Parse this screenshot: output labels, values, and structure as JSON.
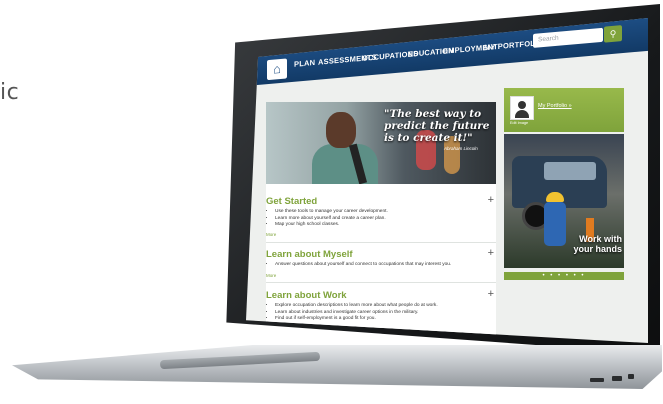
{
  "side_text": "ic",
  "nav": {
    "home_icon": "home-icon",
    "items": [
      "PLAN",
      "ASSESSMENTS",
      "OCCUPATIONS",
      "EDUCATION",
      "EMPLOYMENT",
      "MY PORTFOLIO"
    ],
    "search_placeholder": "Search",
    "search_icon": "search-icon"
  },
  "hero": {
    "quote": "\"The best way to predict the future is to create it!\"",
    "author": "Abraham Lincoln"
  },
  "sections": [
    {
      "title": "Get Started",
      "bullets": [
        "Use these tools to manage your career development.",
        "Learn more about yourself and create a career plan.",
        "Map your high school classes."
      ],
      "more": "More"
    },
    {
      "title": "Learn about Myself",
      "bullets": [
        "Answer questions about yourself and connect to occupations that may interest you."
      ],
      "more": "More"
    },
    {
      "title": "Learn about Work",
      "bullets": [
        "Explore occupation descriptions to learn more about what people do at work.",
        "Learn about industries and investigate career options in the military.",
        "Find out if self-employment is a good fit for you."
      ],
      "more": "More"
    }
  ],
  "profile": {
    "portfolio_link": "My Portfolio »",
    "edit_image": "Edit Image"
  },
  "promo": {
    "caption": "Work with your hands",
    "dots": "• • • • • •"
  },
  "colors": {
    "nav_blue": "#1e4f86",
    "accent_green": "#7fa33b"
  }
}
